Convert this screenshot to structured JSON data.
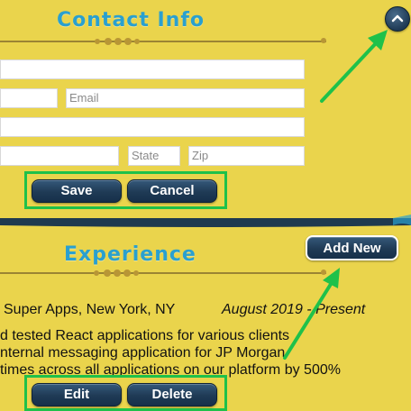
{
  "contact": {
    "title": "Contact Info",
    "email_placeholder": "Email",
    "state_placeholder": "State",
    "zip_placeholder": "Zip",
    "save_label": "Save",
    "cancel_label": "Cancel",
    "scroll_up_icon": "chevron-up-icon"
  },
  "experience": {
    "title": "Experience",
    "add_new_label": "Add New",
    "company": "Super Apps, New York, NY",
    "dates": "August 2019 - Present",
    "bullets": [
      "d tested React applications for various clients",
      "nternal messaging application for JP Morgan",
      "times across all applications on our platform by 500%"
    ],
    "edit_label": "Edit",
    "delete_label": "Delete"
  },
  "colors": {
    "background": "#ead44c",
    "title": "#2aa0cf",
    "button": "#1f3a55",
    "highlight": "#1fc14a"
  }
}
